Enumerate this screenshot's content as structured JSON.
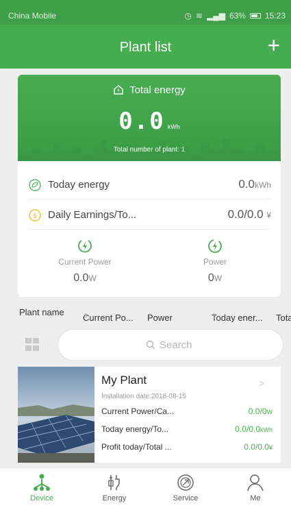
{
  "status": {
    "carrier": "China Mobile",
    "battery": "63%",
    "time": "15:23"
  },
  "header": {
    "title": "Plant list",
    "add_label": "+"
  },
  "summary": {
    "total_label": "Total energy",
    "total_value": "0.0",
    "total_unit": "kWh",
    "plant_count": "Total number of plant: 1",
    "today_energy_label": "Today energy",
    "today_energy_value": "0.0",
    "today_energy_unit": "kWh",
    "earnings_label": "Daily Earnings/To...",
    "earnings_value": "0.0/0.0",
    "earnings_unit": "¥",
    "current_power_label": "Current Power",
    "current_power_value": "0.0",
    "current_power_unit": "W",
    "power_label": "Power",
    "power_value": "0",
    "power_unit": "W"
  },
  "sort": {
    "plant_name": "Plant name",
    "current_power": "Current Po...",
    "power": "Power",
    "today_energy": "Today ener...",
    "total": "Tota"
  },
  "search": {
    "placeholder": "Search"
  },
  "plants": [
    {
      "name": "My Plant",
      "date": "Installation date:2018-08-15",
      "rows": [
        {
          "label": "Current Power/Ca...",
          "value": "0.0/0",
          "unit": "W"
        },
        {
          "label": "Today energy/To...",
          "value": "0.0/0.0",
          "unit": "kWh"
        },
        {
          "label": "Profit today/Total ...",
          "value": "0.0/0.0",
          "unit": "¥"
        }
      ]
    }
  ],
  "tabs": [
    {
      "label": "Device",
      "icon": "device-icon",
      "active": true
    },
    {
      "label": "Energy",
      "icon": "energy-icon",
      "active": false
    },
    {
      "label": "Service",
      "icon": "service-icon",
      "active": false
    },
    {
      "label": "Me",
      "icon": "person-icon",
      "active": false
    }
  ],
  "colors": {
    "primary": "#46ac50",
    "status_bar": "#3f9e48",
    "accent_yellow": "#f2b51c"
  }
}
